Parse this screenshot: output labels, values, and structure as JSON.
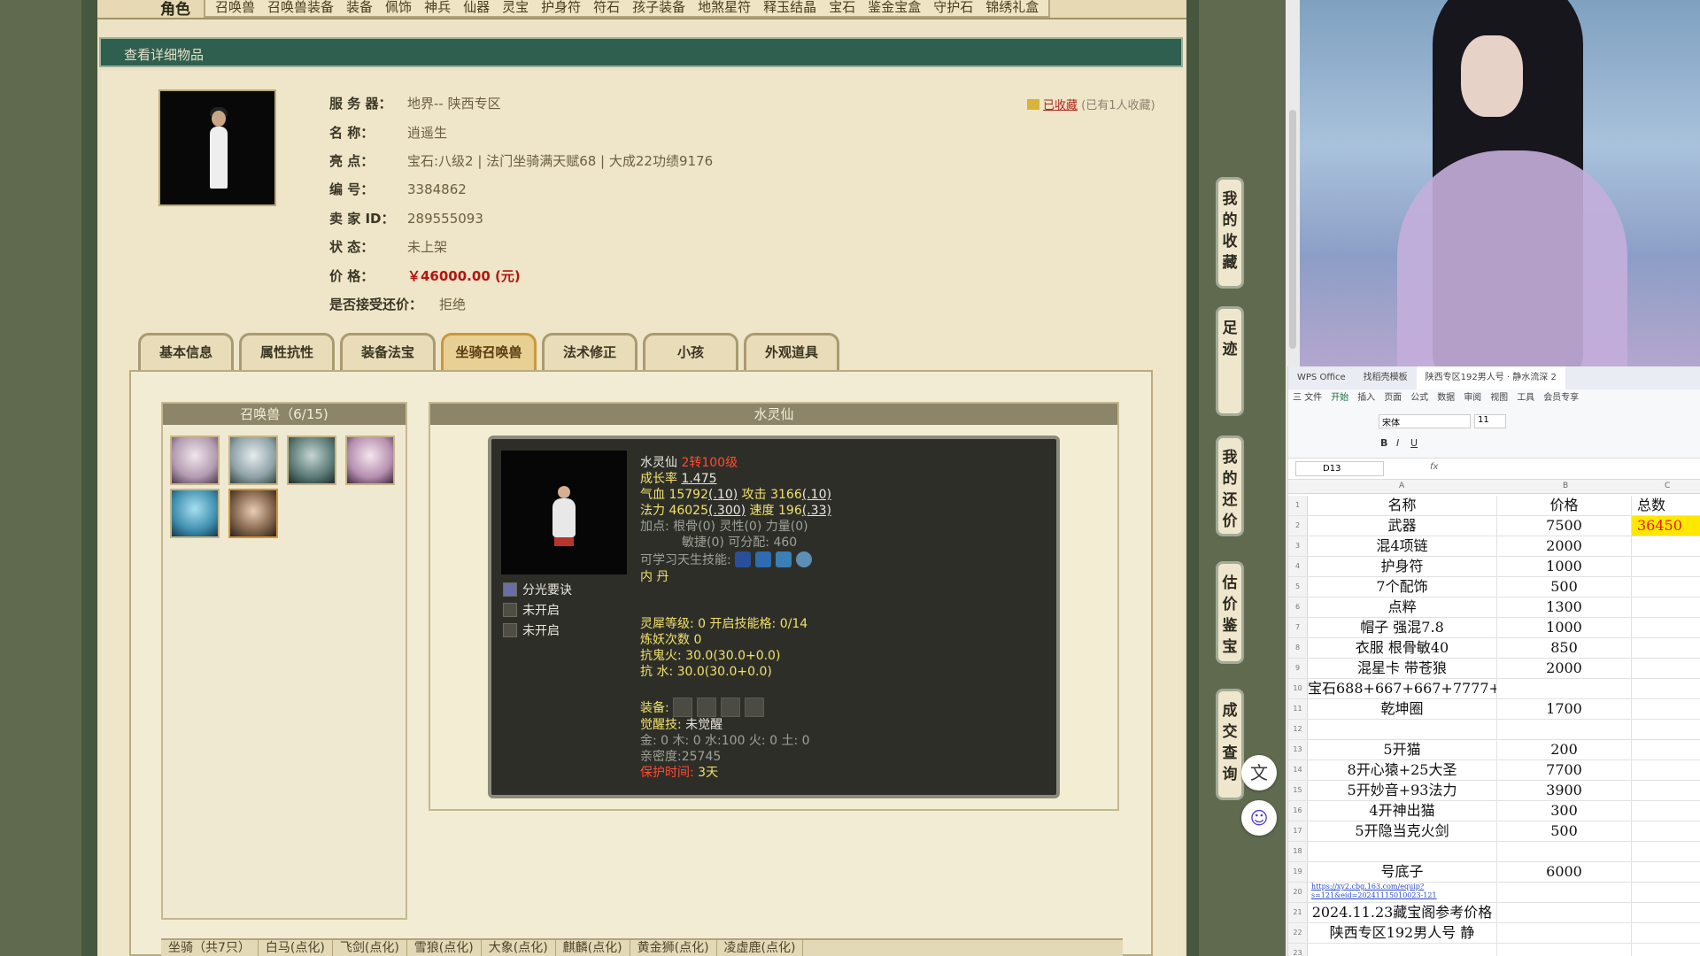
{
  "topnav": {
    "role_label": "角色",
    "tabs": [
      "召唤兽",
      "召唤兽装备",
      "装备",
      "佩饰",
      "神兵",
      "仙器",
      "灵宝",
      "护身符",
      "符石",
      "孩子装备",
      "地煞星符",
      "释玉结晶",
      "宝石",
      "鉴金宝盒",
      "守护石",
      "锦绣礼盒"
    ]
  },
  "detail": {
    "header": "查看详细物品",
    "collect_label": "已收藏",
    "collect_count": "(已有1人收藏)",
    "fields": [
      {
        "key": "服 务 器：",
        "value": "地界-- 陕西专区"
      },
      {
        "key": "名      称：",
        "value": "逍遥生"
      },
      {
        "key": "亮      点：",
        "value": "宝石:八级2 | 法门坐骑满天赋68 | 大成22功绩9176"
      },
      {
        "key": "编      号：",
        "value": "3384862"
      },
      {
        "key": "卖 家 ID：",
        "value": "289555093"
      },
      {
        "key": "状      态：",
        "value": "未上架"
      },
      {
        "key": "价      格：",
        "value": "￥46000.00 (元)"
      },
      {
        "key": "是否接受还价：",
        "value": "拒绝"
      }
    ]
  },
  "tabs": [
    "基本信息",
    "属性抗性",
    "装备法宝",
    "坐骑召唤兽",
    "法术修正",
    "小孩",
    "外观道具"
  ],
  "active_tab": "坐骑召唤兽",
  "pets": {
    "header": "召唤兽（6/15)"
  },
  "pet_detail": {
    "header": "水灵仙",
    "name": "水灵仙",
    "level": "2转100级",
    "growth_label": "成长率",
    "growth": "1.475",
    "hp_label": "气血",
    "hp": "15792",
    "hp_bonus": "(.10)",
    "atk_label": "攻击",
    "atk": "3166",
    "atk_bonus": "(.10)",
    "mp_label": "法力",
    "mp": "46025",
    "mp_bonus": "(.300)",
    "spd_label": "速度",
    "spd": "196",
    "spd_bonus": "(.33)",
    "points_line1": "加点:  根骨(0) 灵性(0) 力量(0)",
    "points_line2": "敏捷(0) 可分配:  460",
    "skills_label": "可学习天生技能:",
    "neidan_label": "内    丹",
    "passives": [
      "分光要诀",
      "未开启",
      "未开启"
    ],
    "lingxi": "灵犀等级:  0 开启技能格:  0/14",
    "lianyao": "炼妖次数 0",
    "resist_ghost": "抗鬼火:  30.0(30.0+0.0)",
    "resist_water": "抗    水:  30.0(30.0+0.0)",
    "equip_label": "装备:",
    "awaken_label": "觉醒技:",
    "awaken_value": "未觉醒",
    "elements": "金: 0 木: 0 水:100 火: 0 土: 0",
    "intimacy": "亲密度:25745",
    "protect_label": "保护时间:",
    "protect_value": "3天"
  },
  "bottom_bar": [
    "坐骑（共7只）",
    "白马(点化)",
    "飞剑(点化)",
    "雪狼(点化)",
    "大象(点化)",
    "麒麟(点化)",
    "黄金狮(点化)",
    "凌虚鹿(点化)"
  ],
  "sidebar": [
    "我的收藏",
    "足迹",
    "我的还价",
    "估价鉴宝",
    "成交查询"
  ],
  "wps": {
    "tabs": [
      "WPS Office",
      "找稻壳模板",
      "陕西专区192男人号 · 静水流深 2"
    ],
    "menu": [
      "三 文件",
      "开始",
      "插入",
      "页面",
      "公式",
      "数据",
      "审阅",
      "视图",
      "工具",
      "会员专享"
    ],
    "active_menu": "开始",
    "font": "宋体",
    "font_size": "11",
    "cell_ref": "D13",
    "fx": "fx",
    "col_headers": [
      "A",
      "B",
      "C"
    ],
    "rows": [
      {
        "n": "1",
        "a": "名称",
        "b": "价格",
        "c": "总数"
      },
      {
        "n": "2",
        "a": "武器",
        "b": "7500",
        "c": "36450"
      },
      {
        "n": "3",
        "a": "混4项链",
        "b": "2000",
        "c": ""
      },
      {
        "n": "4",
        "a": "护身符",
        "b": "1000",
        "c": ""
      },
      {
        "n": "5",
        "a": "7个配饰",
        "b": "500",
        "c": ""
      },
      {
        "n": "6",
        "a": "点粹",
        "b": "1300",
        "c": ""
      },
      {
        "n": "7",
        "a": "帽子 强混7.8",
        "b": "1000",
        "c": ""
      },
      {
        "n": "8",
        "a": "衣服 根骨敏40",
        "b": "850",
        "c": ""
      },
      {
        "n": "9",
        "a": "混星卡 带苍狼",
        "b": "2000",
        "c": ""
      },
      {
        "n": "10",
        "a": "宝石688+667+667+7777+",
        "b": "",
        "c": ""
      },
      {
        "n": "11",
        "a": "乾坤圈",
        "b": "1700",
        "c": ""
      },
      {
        "n": "12",
        "a": "",
        "b": "",
        "c": ""
      },
      {
        "n": "13",
        "a": "5开猫",
        "b": "200",
        "c": ""
      },
      {
        "n": "14",
        "a": "8开心猿+25大圣",
        "b": "7700",
        "c": ""
      },
      {
        "n": "15",
        "a": "5开妙音+93法力",
        "b": "3900",
        "c": ""
      },
      {
        "n": "16",
        "a": "4开神出猫",
        "b": "300",
        "c": ""
      },
      {
        "n": "17",
        "a": "5开隐当克火剑",
        "b": "500",
        "c": ""
      },
      {
        "n": "18",
        "a": "",
        "b": "",
        "c": ""
      },
      {
        "n": "19",
        "a": "号底子",
        "b": "6000",
        "c": ""
      },
      {
        "n": "20",
        "a": "https://xy2.cbg.163.com/equip?s=121&eid=20241115010023-121",
        "b": "",
        "c": ""
      },
      {
        "n": "21",
        "a": "2024.11.23藏宝阁参考价格",
        "b": "",
        "c": ""
      },
      {
        "n": "22",
        "a": "陕西专区192男人号   静",
        "b": "",
        "c": ""
      },
      {
        "n": "23",
        "a": "",
        "b": "",
        "c": ""
      }
    ]
  },
  "colors": {
    "header_green": "#2f5f4e",
    "price_red": "#b4140f",
    "highlight_yellow": "#ffe800"
  }
}
